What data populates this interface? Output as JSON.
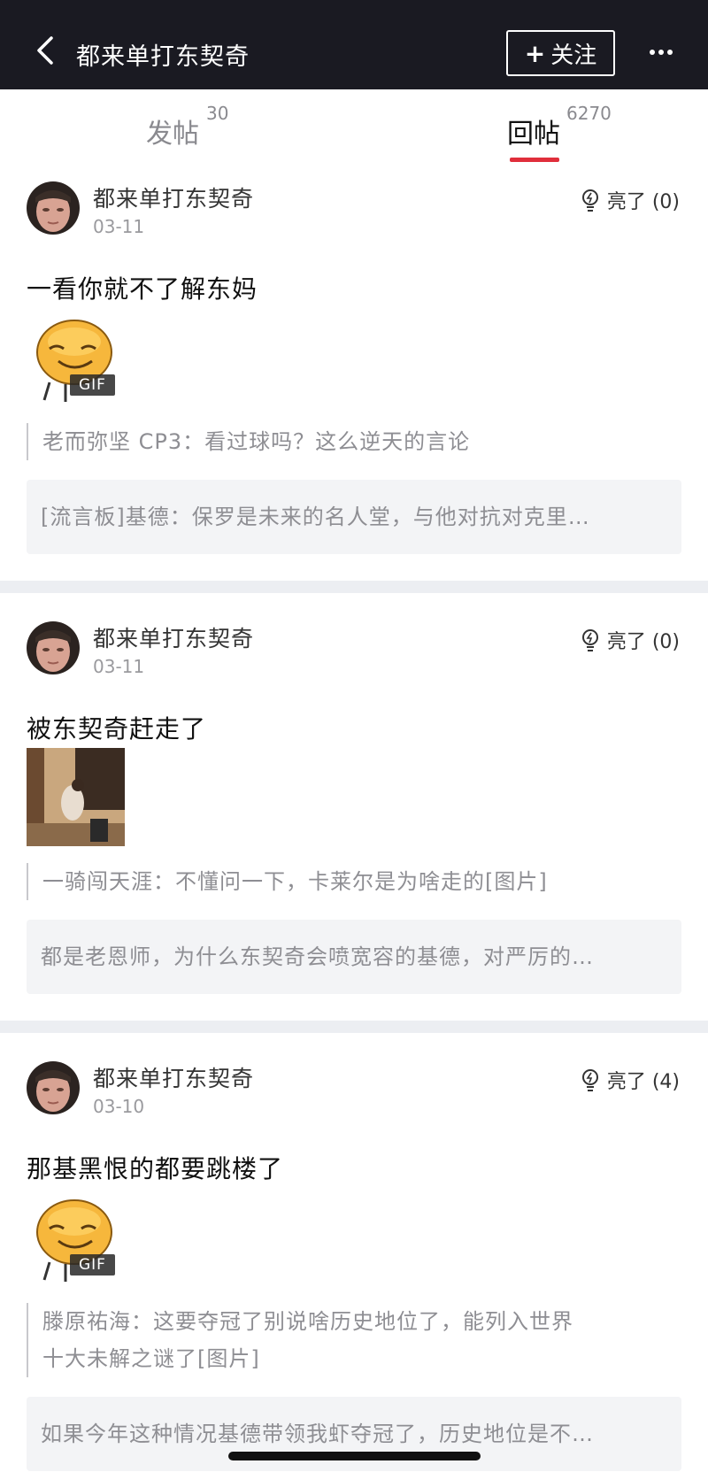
{
  "header": {
    "title": "都来单打东契奇",
    "follow_label": "关注",
    "follow_plus": "+"
  },
  "tabs": [
    {
      "label": "发帖",
      "count": "30"
    },
    {
      "label": "回帖",
      "count": "6270",
      "active": true
    }
  ],
  "posts": [
    {
      "author": "都来单打东契奇",
      "date": "03-11",
      "like_label": "亮了 (0)",
      "text": "一看你就不了解东妈",
      "media": {
        "type": "emoji-gif",
        "badge": "GIF"
      },
      "quote": "老而弥坚 CP3：看过球吗？这么逆天的言论",
      "thread_title": "[流言板]基德：保罗是未来的名人堂，与他对抗对克里…"
    },
    {
      "author": "都来单打东契奇",
      "date": "03-11",
      "like_label": "亮了 (0)",
      "text": "被东契奇赶走了",
      "media": {
        "type": "photo"
      },
      "quote": "一骑闯天涯：不懂问一下，卡莱尔是为啥走的[图片]",
      "thread_title": "都是老恩师，为什么东契奇会喷宽容的基德，对严厉的…"
    },
    {
      "author": "都来单打东契奇",
      "date": "03-10",
      "like_label": "亮了 (4)",
      "text": "那基黑恨的都要跳楼了",
      "media": {
        "type": "emoji-gif",
        "badge": "GIF"
      },
      "quote_line1": "滕原祐海：这要夺冠了别说啥历史地位了，能列入世界",
      "quote_line2": "十大未解之谜了[图片]",
      "thread_title": "如果今年这种情况基德带领我虾夺冠了，历史地位是不…"
    }
  ],
  "colors": {
    "topbar_bg": "#1a1a22",
    "accent_red": "#e02e3b",
    "muted_text": "#8e8e93",
    "thread_bg": "#f3f4f6"
  },
  "icons": [
    "back-arrow-icon",
    "more-dots-icon",
    "lightbulb-icon"
  ]
}
